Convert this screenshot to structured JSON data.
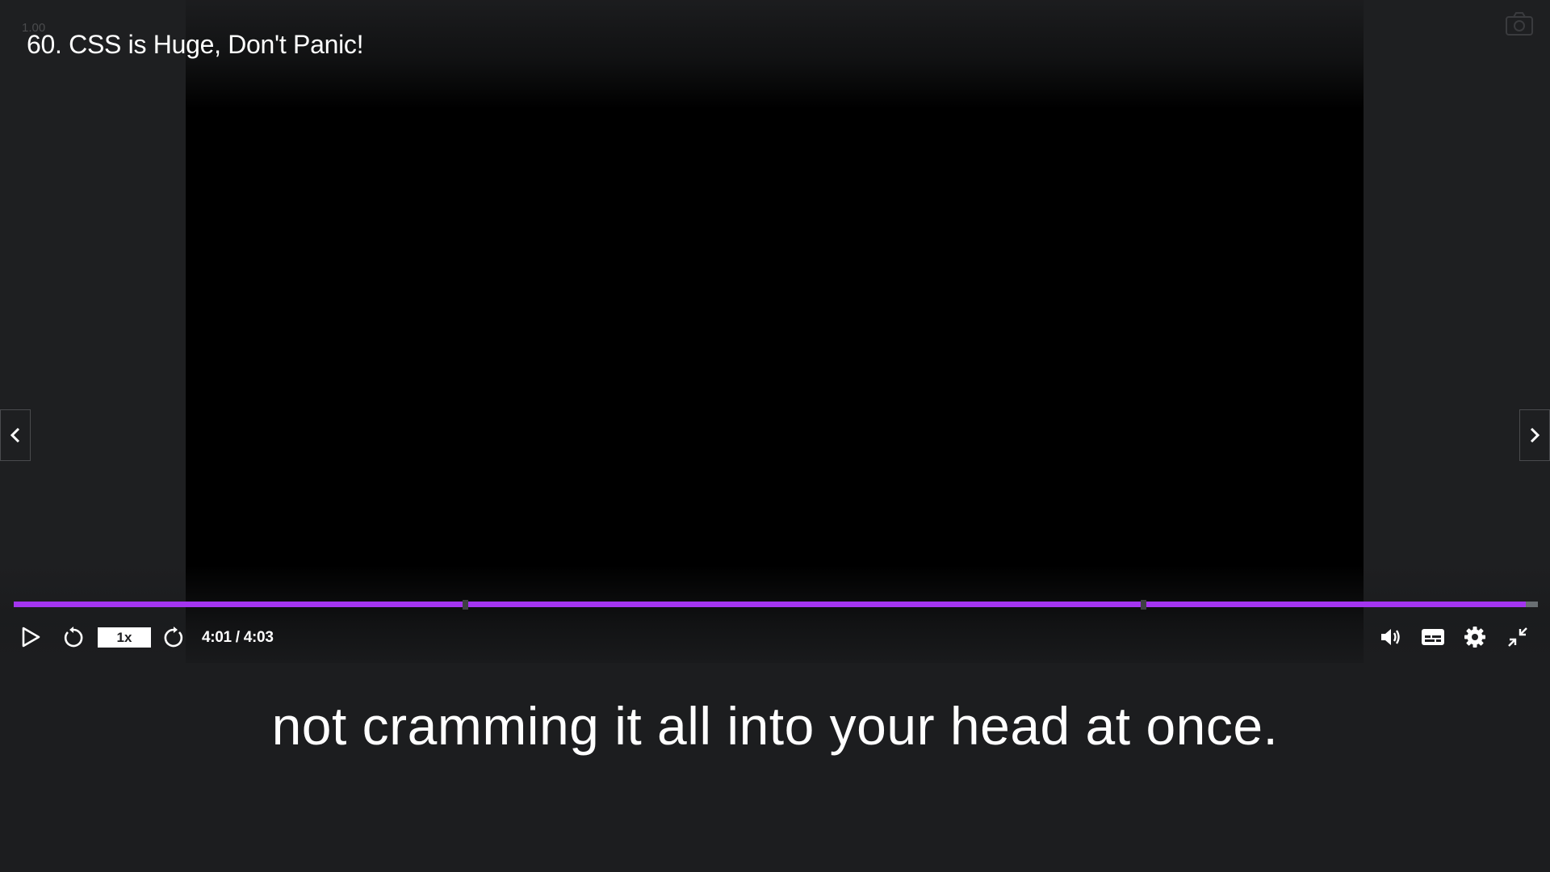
{
  "player": {
    "speed_indicator": "1.00",
    "title": "60. CSS is Huge, Don't Panic!",
    "snapshot_icon": "camera-icon",
    "prev_icon": "chevron-left-icon",
    "next_icon": "chevron-right-icon"
  },
  "progress": {
    "played_fraction": 0.992,
    "chapter_markers": [
      0.296,
      0.741
    ],
    "colors": {
      "played": "#a435f0",
      "track": "#6a6f73"
    }
  },
  "controls": {
    "play_icon": "play-icon",
    "rewind_icon": "rewind-5s-icon",
    "rate_label": "1x",
    "forward_icon": "forward-5s-icon",
    "time": "4:01 / 4:03",
    "volume_icon": "volume-icon",
    "captions_icon": "captions-icon",
    "settings_icon": "gear-icon",
    "exit_fullscreen_icon": "exit-fullscreen-icon"
  },
  "caption": {
    "text": "not cramming it all into your head at once."
  }
}
